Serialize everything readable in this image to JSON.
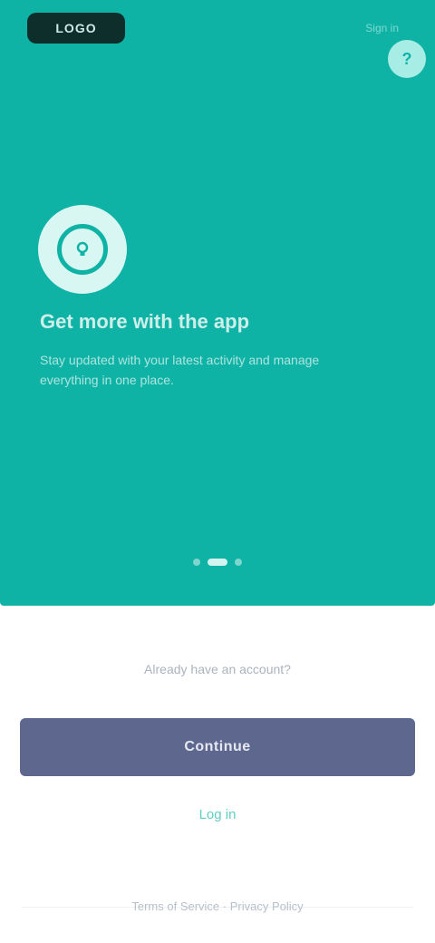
{
  "app": {
    "logo_text": "LOGO"
  },
  "header": {
    "top_link": "Sign in",
    "help_label": "?"
  },
  "hero": {
    "icon": "tip-icon",
    "title": "Get more with the app",
    "description": "Stay updated with your latest activity and manage everything in one place."
  },
  "pager": {
    "count": 3,
    "active_index": 1
  },
  "auth": {
    "prompt": "Already have an account?",
    "primary_button": "Continue",
    "secondary_link": "Log in"
  },
  "footer": {
    "text": "Terms of Service · Privacy Policy"
  },
  "colors": {
    "hero_bg": "#0fb3a6",
    "primary_btn": "#5e688e",
    "accent_link": "#5fcfc2"
  }
}
